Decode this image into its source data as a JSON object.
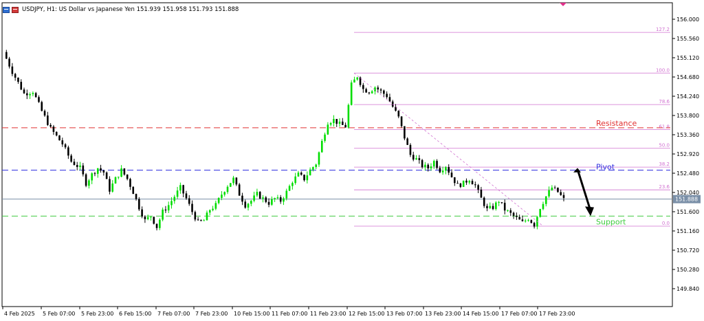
{
  "header": {
    "symbol": "USDJPY",
    "timeframe": "H1",
    "description": "US Dollar vs Japanese Yen",
    "ohlc": "151.939 151.958 151.793 151.888",
    "title_text": "USDJPY, H1:  US Dollar vs Japanese Yen  151.939 151.958 151.793 151.888"
  },
  "chart_data": {
    "type": "candlestick",
    "y_axis": {
      "ylim": [
        149.6,
        156.2
      ],
      "ticks": [
        "156.000",
        "155.560",
        "155.120",
        "154.680",
        "154.240",
        "153.800",
        "153.360",
        "152.920",
        "152.480",
        "152.040",
        "151.600",
        "151.160",
        "150.720",
        "150.280",
        "149.840"
      ],
      "tick_values": [
        156.0,
        155.56,
        155.12,
        154.68,
        154.24,
        153.8,
        153.36,
        152.92,
        152.48,
        152.04,
        151.6,
        151.16,
        150.72,
        150.28,
        149.84
      ],
      "current_price": 151.888,
      "current_price_label": "151.888"
    },
    "x_axis": {
      "labels": [
        "4 Feb 2025",
        "5 Feb 07:00",
        "5 Feb 23:00",
        "6 Feb 15:00",
        "7 Feb 07:00",
        "7 Feb 23:00",
        "10 Feb 15:00",
        "11 Feb 07:00",
        "11 Feb 23:00",
        "12 Feb 15:00",
        "13 Feb 07:00",
        "13 Feb 23:00",
        "14 Feb 15:00",
        "17 Feb 07:00",
        "17 Feb 23:00"
      ]
    },
    "bull_color": "#00dd00",
    "bear_color": "#000000",
    "price_path": [
      [
        0,
        155.25
      ],
      [
        3,
        154.8
      ],
      [
        7,
        154.3
      ],
      [
        10,
        154.35
      ],
      [
        13,
        153.9
      ],
      [
        16,
        153.5
      ],
      [
        20,
        153.15
      ],
      [
        23,
        152.75
      ],
      [
        26,
        152.6
      ],
      [
        28,
        152.25
      ],
      [
        30,
        152.45
      ],
      [
        32,
        152.6
      ],
      [
        34,
        152.5
      ],
      [
        36,
        152.1
      ],
      [
        38,
        152.35
      ],
      [
        40,
        152.55
      ],
      [
        42,
        152.35
      ],
      [
        44,
        152.05
      ],
      [
        46,
        151.7
      ],
      [
        48,
        151.4
      ],
      [
        50,
        151.5
      ],
      [
        52,
        151.25
      ],
      [
        54,
        151.6
      ],
      [
        56,
        151.75
      ],
      [
        58,
        151.95
      ],
      [
        60,
        152.15
      ],
      [
        62,
        151.9
      ],
      [
        64,
        151.6
      ],
      [
        66,
        151.35
      ],
      [
        68,
        151.4
      ],
      [
        70,
        151.65
      ],
      [
        72,
        151.75
      ],
      [
        74,
        152.0
      ],
      [
        76,
        152.2
      ],
      [
        78,
        152.35
      ],
      [
        80,
        152.0
      ],
      [
        82,
        151.75
      ],
      [
        84,
        151.85
      ],
      [
        86,
        152.0
      ],
      [
        88,
        151.9
      ],
      [
        90,
        151.8
      ],
      [
        92,
        151.9
      ],
      [
        94,
        151.85
      ],
      [
        96,
        152.05
      ],
      [
        98,
        152.3
      ],
      [
        100,
        152.45
      ],
      [
        102,
        152.35
      ],
      [
        104,
        152.55
      ],
      [
        106,
        152.7
      ],
      [
        108,
        153.2
      ],
      [
        110,
        153.65
      ],
      [
        112,
        153.7
      ],
      [
        114,
        153.6
      ],
      [
        116,
        153.55
      ],
      [
        118,
        154.5
      ],
      [
        120,
        154.7
      ],
      [
        122,
        154.4
      ],
      [
        124,
        154.35
      ],
      [
        126,
        154.45
      ],
      [
        128,
        154.35
      ],
      [
        130,
        154.25
      ],
      [
        132,
        154.0
      ],
      [
        134,
        153.75
      ],
      [
        136,
        153.3
      ],
      [
        138,
        152.9
      ],
      [
        140,
        152.8
      ],
      [
        142,
        152.65
      ],
      [
        144,
        152.6
      ],
      [
        146,
        152.75
      ],
      [
        148,
        152.55
      ],
      [
        150,
        152.65
      ],
      [
        152,
        152.4
      ],
      [
        154,
        152.2
      ],
      [
        156,
        152.25
      ],
      [
        158,
        152.35
      ],
      [
        160,
        152.2
      ],
      [
        162,
        151.9
      ],
      [
        164,
        151.65
      ],
      [
        166,
        151.7
      ],
      [
        168,
        151.85
      ],
      [
        170,
        151.65
      ],
      [
        172,
        151.55
      ],
      [
        174,
        151.45
      ],
      [
        176,
        151.35
      ],
      [
        178,
        151.45
      ],
      [
        180,
        151.3
      ],
      [
        182,
        151.7
      ],
      [
        184,
        151.95
      ],
      [
        186,
        152.15
      ],
      [
        188,
        152.05
      ],
      [
        190,
        151.88
      ]
    ],
    "fibonacci": {
      "levels": [
        {
          "label": "127.2",
          "value": 155.7
        },
        {
          "label": "100.0",
          "value": 154.77
        },
        {
          "label": "78.6",
          "value": 154.05
        },
        {
          "label": "61.8",
          "value": 153.48
        },
        {
          "label": "50.0",
          "value": 153.05
        },
        {
          "label": "38.2",
          "value": 152.62
        },
        {
          "label": "23.6",
          "value": 152.1
        },
        {
          "label": "0.0",
          "value": 151.27
        }
      ],
      "color": "#d070d0"
    },
    "lines": [
      {
        "name": "resistance",
        "label": "Resistance",
        "value": 153.52,
        "color": "#e03030"
      },
      {
        "name": "pivot",
        "label": "Pivot",
        "value": 152.55,
        "color": "#3030e0"
      },
      {
        "name": "support",
        "label": "Support",
        "value": 151.5,
        "color": "#40cc40"
      }
    ],
    "grid": false,
    "annotations": {
      "down_arrow": "black arrow pointing from pivot to support",
      "fib_diagonal": "dashed diagonal from 100.0 swing high to 0.0 swing low"
    }
  }
}
